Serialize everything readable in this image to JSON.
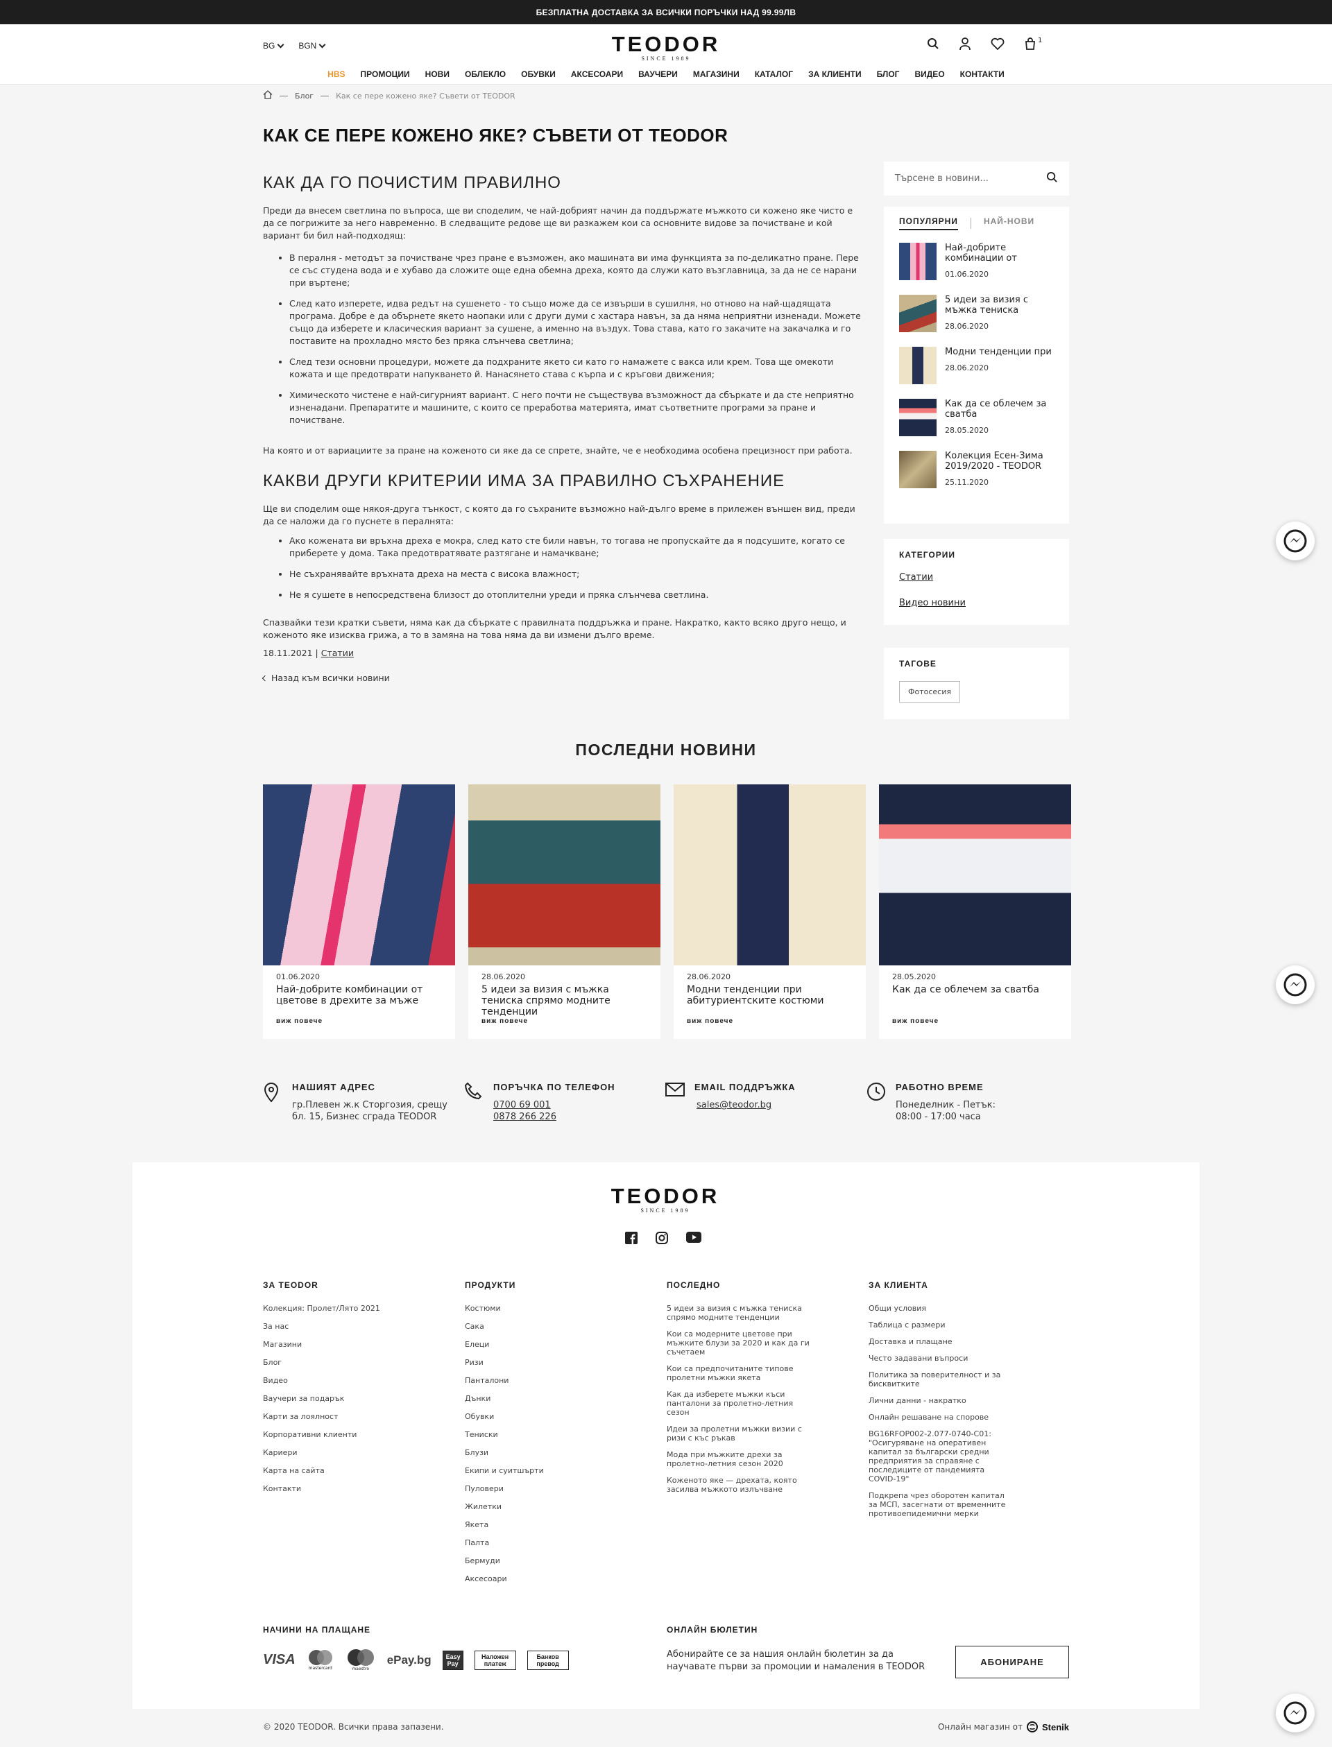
{
  "topbar": {
    "text": "БЕЗПЛАТНА ДОСТАВКА ЗА ВСИЧКИ ПОРЪЧКИ НАД 99.99ЛВ"
  },
  "header": {
    "lang": "BG",
    "currency": "BGN",
    "logo": "TEODOR",
    "logo_since": "SINCE 1989",
    "cart_count": "1"
  },
  "nav": [
    "HBS",
    "ПРОМОЦИИ",
    "НОВИ",
    "ОБЛЕКЛО",
    "ОБУВКИ",
    "АКСЕСОАРИ",
    "ВАУЧЕРИ",
    "МАГАЗИНИ",
    "КАТАЛОГ",
    "ЗА КЛИЕНТИ",
    "БЛОГ",
    "ВИДЕО",
    "КОНТАКТИ"
  ],
  "breadcrumb": {
    "blog": "Блог",
    "current": "Как се пере кожено яке? Съвети от TEODOR"
  },
  "title": "КАК СЕ ПЕРЕ КОЖЕНО ЯКЕ? СЪВЕТИ ОТ TEODOR",
  "article": {
    "h1": "КАК ДА ГО ПОЧИСТИМ ПРАВИЛНО",
    "p1": "Преди да внесем светлина по въпроса, ще ви споделим, че най-добрият начин да поддържате мъжкото си кожено яке чисто е да се погрижите за него навременно. В следващите редове ще ви разкажем кои са основните видове за почистване и кой вариант би бил най-подходящ:",
    "list1": [
      "В пералня - методът за почистване чрез пране е възможен, ако машината ви има функцията за по-деликатно пране. Пере се със студена вода и е хубаво да сложите още една обемна дреха, която да служи като възглавница, за да не се нарани при въртене;",
      "След като изперете, идва редът на сушенето - то също може да се извърши в сушилня, но отново на най-щадящата програма. Добре е да обърнете якето наопаки или с други думи с хастара навън, за да няма неприятни изненади. Можете също да изберете и класическия вариант за сушене, а именно на въздух. Това става, като го закачите на закачалка и го поставите на прохладно място без пряка слънчева светлина;",
      "След тези основни процедури, можете да подхраните якето си като го намажете с вакса или крем. Това ще омекоти кожата и ще предотврати напукването й. Нанасянето става с кърпа и с кръгови движения;",
      "Химическото чистене е най-сигурният вариант. С него почти не съществува възможност да сбъркате и да сте неприятно изненадани. Препаратите и машините, с които се преработва материята, имат съответните програми за пране и почистване."
    ],
    "p2": "На която и от вариациите за пране на коженото си яке да се спрете, знайте, че е необходима особена прецизност при работа.",
    "h2": "КАКВИ ДРУГИ КРИТЕРИИ ИМА ЗА ПРАВИЛНО СЪХРАНЕНИЕ",
    "p3": "Ще ви споделим още някоя-друга тънкост, с която да го съхраните възможно най-дълго време в прилежен външен вид, преди да се наложи да го пуснете в пералнята:",
    "list2": [
      "Ако кожената ви връхна дреха е мокра, след като сте били навън, то тогава не пропускайте да я подсушите, когато се приберете у дома. Така предотвратявате разтягане и намачкване;",
      "Не съхранявайте връхната дреха на места с висока влажност;",
      "Не я сушете в непосредствена близост до отоплителни уреди и пряка слънчева светлина."
    ],
    "p4": "Спазвайки тези кратки съвети, няма как да сбъркате с правилната поддръжка и пране. Накратко, както всяко друго нещо, и коженото яке изисква грижа, а то в замяна на това няма да ви измени дълго време.",
    "date": "18.11.2021 |",
    "category": "Статии",
    "back": "Назад към всички новини"
  },
  "sidebar": {
    "search_placeholder": "Търсене в новини...",
    "tab_popular": "ПОПУЛЯРНИ",
    "tab_new": "НАЙ-НОВИ",
    "popular": [
      {
        "title": "Най-добрите комбинации от",
        "date": "01.06.2020",
        "color": "#3a5688"
      },
      {
        "title": "5 идеи за визия с мъжка тениска",
        "date": "28.06.2020",
        "color": "#8a7a5a"
      },
      {
        "title": "Модни тенденции при",
        "date": "28.06.2020",
        "color": "#d8c9a6"
      },
      {
        "title": "Как да се облечем за сватба",
        "date": "28.05.2020",
        "color": "#2a3450"
      },
      {
        "title": "Колекция Есен-Зима 2019/2020 - TEODOR",
        "date": "25.11.2020",
        "color": "#9a8a66"
      }
    ],
    "categories_title": "КАТЕГОРИИ",
    "categories": [
      "Статии",
      "Видео новини"
    ],
    "tags_title": "ТАГОВЕ",
    "tags": [
      "Фотосесия"
    ]
  },
  "latest": {
    "title": "ПОСЛЕДНИ НОВИНИ",
    "more": "виж повече",
    "cards": [
      {
        "date": "01.06.2020",
        "title": "Най-добрите комбинации от цветове в дрехите за мъже"
      },
      {
        "date": "28.06.2020",
        "title": "5 идеи за визия с мъжка тениска спрямо модните тенденции"
      },
      {
        "date": "28.06.2020",
        "title": "Модни тенденции при абитуриентските костюми"
      },
      {
        "date": "28.05.2020",
        "title": "Как да се облечем за сватба"
      }
    ]
  },
  "contacts": {
    "address": {
      "title": "НАШИЯТ АДРЕС",
      "line1": "гр.Плевен ж.к Сторгозия, срещу",
      "line2": "бл. 15, Бизнес сграда TEODOR"
    },
    "phone": {
      "title": "ПОРЪЧКА ПО ТЕЛЕФОН",
      "p1": "0700 69 001",
      "p2": "0878 266 226"
    },
    "email": {
      "title": "EMAIL ПОДДРЪЖКА",
      "value": "sales@teodor.bg"
    },
    "hours": {
      "title": "РАБОТНО ВРЕМЕ",
      "line1": "Понеделник - Петък:",
      "line2": "08:00 - 17:00 часа"
    }
  },
  "footer": {
    "col1": {
      "title": "ЗА TEODOR",
      "items": [
        "Колекция: Пролет/Лято 2021",
        "За нас",
        "Магазини",
        "Блог",
        "Видео",
        "Ваучери за подарък",
        "Карти за лоялност",
        "Корпоративни клиенти",
        "Кариери",
        "Карта на сайта",
        "Контакти"
      ]
    },
    "col2": {
      "title": "ПРОДУКТИ",
      "items": [
        "Костюми",
        "Сака",
        "Елеци",
        "Ризи",
        "Панталони",
        "Дънки",
        "Обувки",
        "Тениски",
        "Блузи",
        "Екипи и суитшърти",
        "Пуловери",
        "Жилетки",
        "Якета",
        "Палта",
        "Бермуди",
        "Аксесоари"
      ]
    },
    "col3": {
      "title": "ПОСЛЕДНО",
      "items": [
        "5 идеи за визия с мъжка тениска спрямо модните тенденции",
        "Кои са модерните цветове при мъжките блузи за 2020 и как да ги съчетаем",
        "Кои са предпочитаните типове пролетни мъжки якета",
        "Как да изберете мъжки къси панталони за пролетно-летния сезон",
        "Идеи за пролетни мъжки визии с ризи с къс ръкав",
        "Мода при мъжките дрехи за пролетно-летния сезон 2020",
        "Коженото яке — дрехата, която засилва мъжкото излъчване"
      ]
    },
    "col4": {
      "title": "ЗА КЛИЕНТА",
      "items": [
        "Общи условия",
        "Таблица с размери",
        "Доставка и плащане",
        "Често задавани въпроси",
        "Политика за поверителност и за бисквитките",
        "Лични данни - накратко",
        "Онлайн решаване на спорове",
        "BG16RFOP002-2.077-0740-C01: \"Осигуряване на оперативен капитал за български средни предприятия за справяне с последиците от пандемията COVID-19\"",
        "Подкрепа чрез оборотен капитал за МСП, засегнати от временните противоепидемични мерки"
      ]
    },
    "pay_title": "НАЧИНИ НА ПЛАЩАНЕ",
    "pay": {
      "visa": "VISA",
      "mastercard": "mastercard",
      "maestro": "maestro",
      "epay": "ePay.bg",
      "easypay": "Easy Pay",
      "cod": "Наложен платеж",
      "bank": "Банков превод"
    },
    "news_title": "ОНЛАЙН БЮЛЕТИН",
    "news_text": "Абонирайте се за нашия онлайн бюлетин за да научавате първи за промоции и намаления в TEODOR",
    "subscribe": "АБОНИРАНЕ",
    "copyright": "© 2020 TEODOR. Всички права запазени.",
    "online_by": "Онлайн магазин от",
    "stenik": "Stenik"
  },
  "colors": {
    "accent": "#e8952d",
    "dark": "#1e1e1e",
    "bg": "#f5f5f5"
  }
}
